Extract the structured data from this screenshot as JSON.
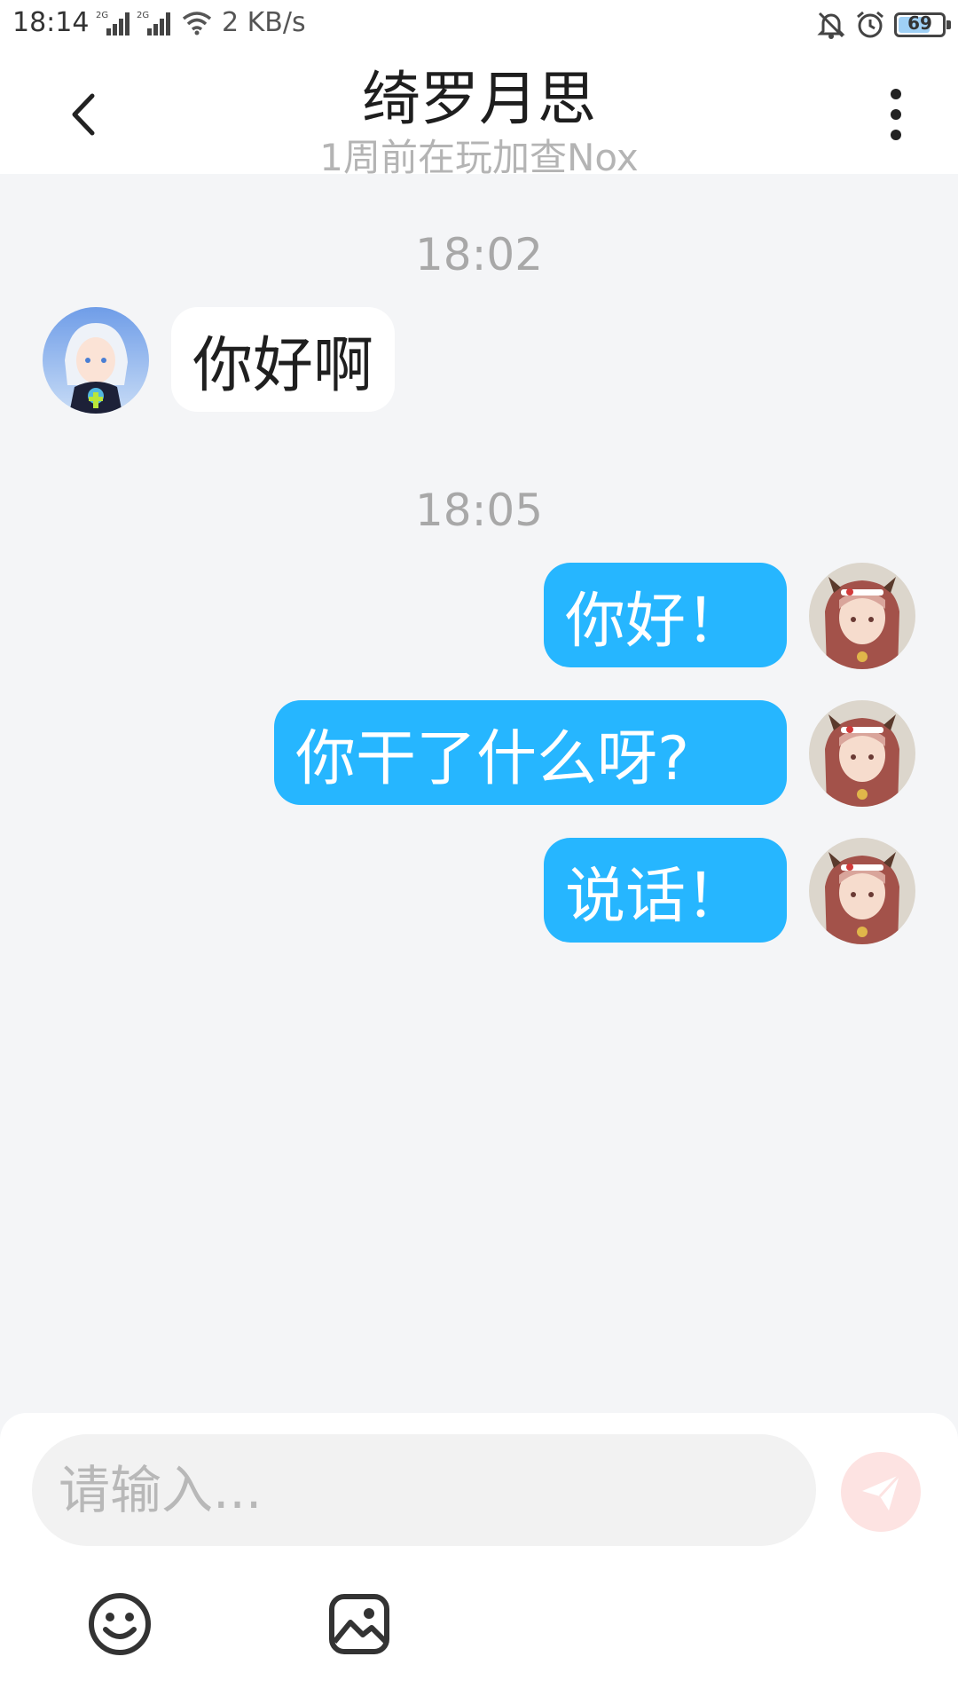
{
  "status_bar": {
    "time": "18:14",
    "network_speed": "2 KB/s",
    "battery_level": "69",
    "signal_1_label": "2G",
    "signal_2_label": "2G"
  },
  "header": {
    "title": "绮罗月思",
    "subtitle": "1周前在玩加查Nox"
  },
  "messages": [
    {
      "type": "timestamp",
      "text": "18:02"
    },
    {
      "type": "incoming",
      "text": "你好啊"
    },
    {
      "type": "timestamp",
      "text": "18:05"
    },
    {
      "type": "outgoing",
      "text": "你好！"
    },
    {
      "type": "outgoing",
      "text": "你干了什么呀?"
    },
    {
      "type": "outgoing",
      "text": "说话！"
    }
  ],
  "composer": {
    "placeholder": "请输入..."
  },
  "colors": {
    "outgoing_bubble": "#26b6ff",
    "incoming_bubble": "#ffffff",
    "background": "#f4f5f7",
    "send_button": "#fde3e2"
  },
  "icons": {
    "back": "chevron-left-icon",
    "more": "more-vertical-icon",
    "send": "paper-plane-icon",
    "emoji": "smiley-icon",
    "image": "image-icon"
  }
}
